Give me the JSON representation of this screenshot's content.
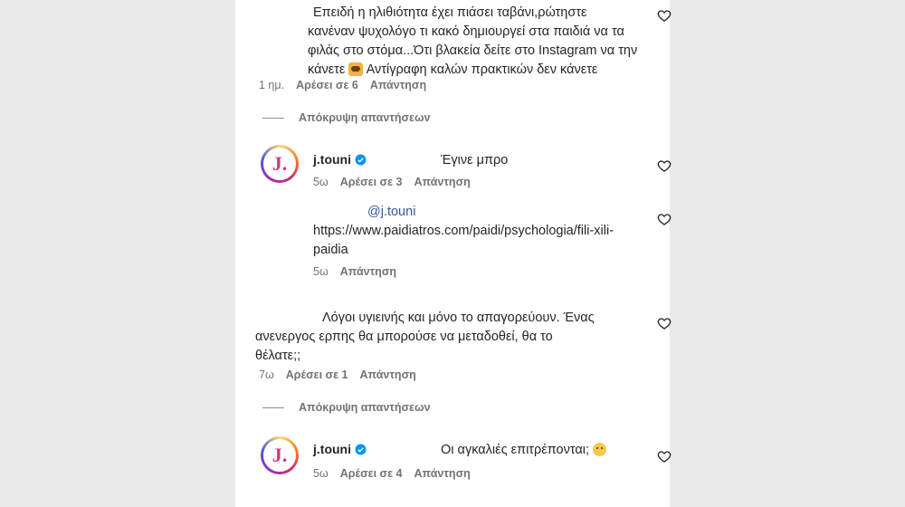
{
  "comments": [
    {
      "text_lines": [
        "Επειδή η ηλιθιότητα έχει πιάσει ταβάνι,ρώτηστε",
        "κανέναν ψυχολόγο τι κακό δημιουργεί στα παιδιά να τα",
        "φιλάς στο στόμα...Ότι βλακεία δείτε στο Instagram να την",
        "κάνετε",
        "Αντίγραφη καλών πρακτικών δεν κάνετε"
      ],
      "emoji": "emoji-hands-icon",
      "time": "1 ημ.",
      "likes": "Αρέσει σε 6",
      "reply": "Απάντηση"
    },
    {
      "username": "j.touni",
      "text": "Έγινε μπρο",
      "time": "5ω",
      "likes": "Αρέσει σε 3",
      "reply": "Απάντηση"
    },
    {
      "mention": "@j.touni",
      "link_lines": [
        "https://www.paidiatros.com/paidi/psychologia/fili-xili-",
        "paidia"
      ],
      "time": "5ω",
      "reply": "Απάντηση"
    },
    {
      "text_lines": [
        "Λόγοι υγιεινής και μόνο το απαγορεύουν. Ένας",
        "ανενεργος ερπης θα μπορούσε να μεταδοθεί, θα το",
        "θέλατε;;"
      ],
      "time": "7ω",
      "likes": "Αρέσει σε 1",
      "reply": "Απάντηση"
    },
    {
      "username": "j.touni",
      "text": "Οι αγκαλιές επιτρέπονται;",
      "emoji": "thinking-face-icon",
      "time": "5ω",
      "likes": "Αρέσει σε 4",
      "reply": "Απάντηση"
    }
  ],
  "hide_replies_label": "Απόκρυψη απαντήσεων",
  "avatar_letter": "J.",
  "colors": {
    "accent": "#d1377c",
    "verified": "#0095f6",
    "muted": "#737373"
  }
}
